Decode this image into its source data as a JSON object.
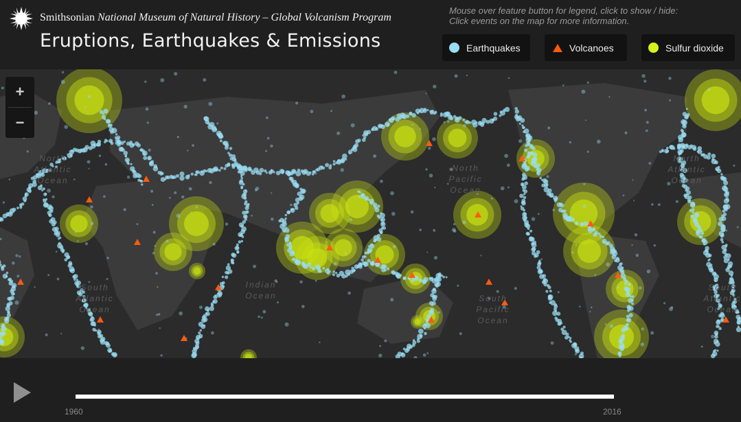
{
  "header": {
    "org_name": "Smithsonian",
    "org_rest": "National Museum of Natural History – Global Volcanism Program",
    "title": "Eruptions, Earthquakes & Emissions",
    "hint_line1": "Mouse over feature button for legend, click to show / hide:",
    "hint_line2": "Click events on the map for more information."
  },
  "legend": [
    {
      "label": "Earthquakes",
      "color": "#9adcf2",
      "shape": "circle"
    },
    {
      "label": "Volcanoes",
      "color": "#ff5a0f",
      "shape": "triangle"
    },
    {
      "label": "Sulfur dioxide",
      "color": "#d6f21a",
      "shape": "circle"
    }
  ],
  "zoom": {
    "in": "+",
    "out": "−"
  },
  "map_labels": {
    "north_atlantic": [
      "North",
      "Atlantic",
      "Ocean"
    ],
    "north_pacific": [
      "North",
      "Pacific",
      "Ocean"
    ],
    "south_atlantic": [
      "South",
      "Atlantic",
      "Ocean"
    ],
    "south_pacific": [
      "South",
      "Pacific",
      "Ocean"
    ],
    "indian": [
      "Indian",
      "Ocean"
    ]
  },
  "timeline": {
    "start_year": "1960",
    "end_year": "2016"
  },
  "icons": {
    "logo": "sun-logo-icon",
    "play": "play-icon"
  },
  "colors": {
    "quake": "#9adcf2",
    "volcano": "#ff5a0f",
    "so2": "#c8e012",
    "land": "#3a3a3a",
    "ocean": "#2b2b2b"
  }
}
